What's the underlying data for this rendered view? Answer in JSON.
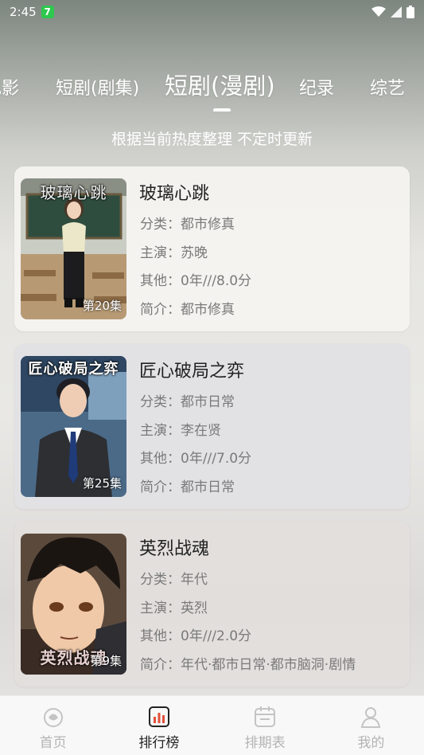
{
  "status": {
    "time": "2:45",
    "app_badge": "7"
  },
  "tabs": [
    {
      "label": "电影"
    },
    {
      "label": "短剧(剧集)"
    },
    {
      "label": "短剧(漫剧)"
    },
    {
      "label": "纪录"
    },
    {
      "label": "综艺"
    }
  ],
  "active_tab_index": 2,
  "subtitle": "根据当前热度整理 不定时更新",
  "items": [
    {
      "title": "玻璃心跳",
      "poster_title": "玻璃心跳",
      "episodes": "第20集",
      "category": "分类：都市修真",
      "cast": "主演：苏晚",
      "other": "其他：0年///8.0分",
      "intro": "简介：都市修真"
    },
    {
      "title": "匠心破局之弈",
      "poster_title": "匠心破局之弈",
      "episodes": "第25集",
      "category": "分类：都市日常",
      "cast": "主演：李在贤",
      "other": "其他：0年///7.0分",
      "intro": "简介：都市日常"
    },
    {
      "title": "英烈战魂",
      "poster_title": "英烈战魂",
      "episodes": "第9集",
      "category": "分类：年代",
      "cast": "主演：英烈",
      "other": "其他：0年///2.0分",
      "intro": "简介：年代·都市日常·都市脑洞·剧情"
    }
  ],
  "nav": [
    {
      "label": "首页",
      "icon": "home-icon"
    },
    {
      "label": "排行榜",
      "icon": "ranking-icon"
    },
    {
      "label": "排期表",
      "icon": "schedule-icon"
    },
    {
      "label": "我的",
      "icon": "profile-icon"
    }
  ],
  "active_nav_index": 1,
  "colors": {
    "nav_active": "#e2503a",
    "nav_inactive": "#b4b4b4"
  }
}
